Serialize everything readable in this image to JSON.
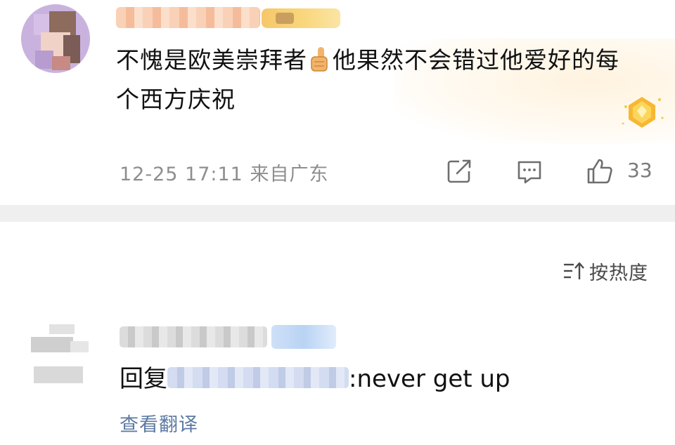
{
  "comment": {
    "text_before_emoji": "不愧是欧美崇拜者",
    "emoji": "thumbs-up-icon",
    "text_after_emoji": "他果然不会错过他爱好的每个西方庆祝",
    "time": "12-25 17:11",
    "location": "来自广东",
    "like_count": "33",
    "icons": {
      "share": "share-icon",
      "reply": "comment-icon",
      "like": "like-icon",
      "medal": "medal-icon"
    }
  },
  "sort": {
    "label": "按热度",
    "icon": "sort-icon"
  },
  "reply": {
    "prefix": "回复",
    "suffix": ":never get up",
    "translate_label": "查看翻译"
  },
  "colors": {
    "divider": "#efefef",
    "meta_text": "#8e8e8e",
    "link_blue": "#5d7aa3"
  }
}
